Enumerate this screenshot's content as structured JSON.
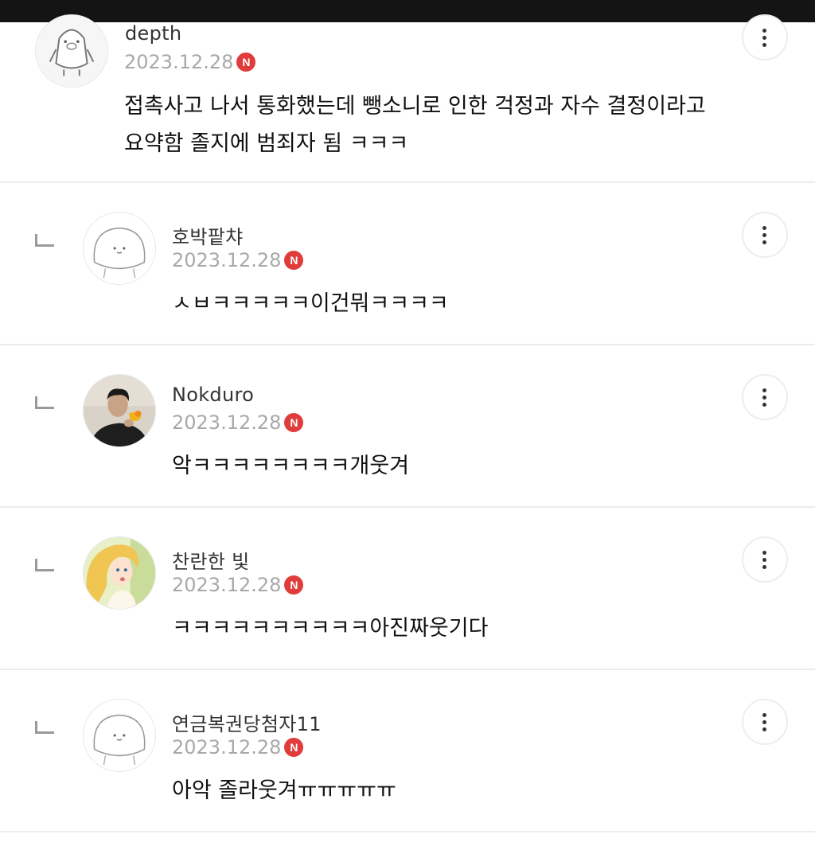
{
  "comments": [
    {
      "nickname": "depth",
      "date": "2023.12.28",
      "badge": "N",
      "avatar": "penguin-avatar-icon",
      "text_lines": [
        "접촉사고 나서 통화했는데 뺑소니로 인한 걱정과 자수 결정이라고",
        "요약함 졸지에 범죄자 됨 ㅋㅋㅋ"
      ]
    },
    {
      "nickname": "호박팥챠",
      "date": "2023.12.28",
      "badge": "N",
      "avatar": "default-blob-avatar-icon",
      "text_lines": [
        "ㅅㅂㅋㅋㅋㅋㅋ이건뭐ㅋㅋㅋㅋ"
      ]
    },
    {
      "nickname": "Nokduro",
      "date": "2023.12.28",
      "badge": "N",
      "avatar": "person-with-bird-photo",
      "text_lines": [
        "악ㅋㅋㅋㅋㅋㅋㅋㅋ개웃겨"
      ]
    },
    {
      "nickname": "찬란한 빛",
      "date": "2023.12.28",
      "badge": "N",
      "avatar": "illustrated-girl-photo",
      "text_lines": [
        "ㅋㅋㅋㅋㅋㅋㅋㅋㅋㅋ아진짜웃기다"
      ]
    },
    {
      "nickname": "연금복권당첨자11",
      "date": "2023.12.28",
      "badge": "N",
      "avatar": "default-blob-avatar-icon",
      "text_lines": [
        "아악 졸라웃겨ㅠㅠㅠㅠㅠ"
      ]
    }
  ],
  "colors": {
    "badge": "#e03c3c",
    "date": "#a8a8a8",
    "divider": "#ececec",
    "top_bar": "#141414"
  }
}
